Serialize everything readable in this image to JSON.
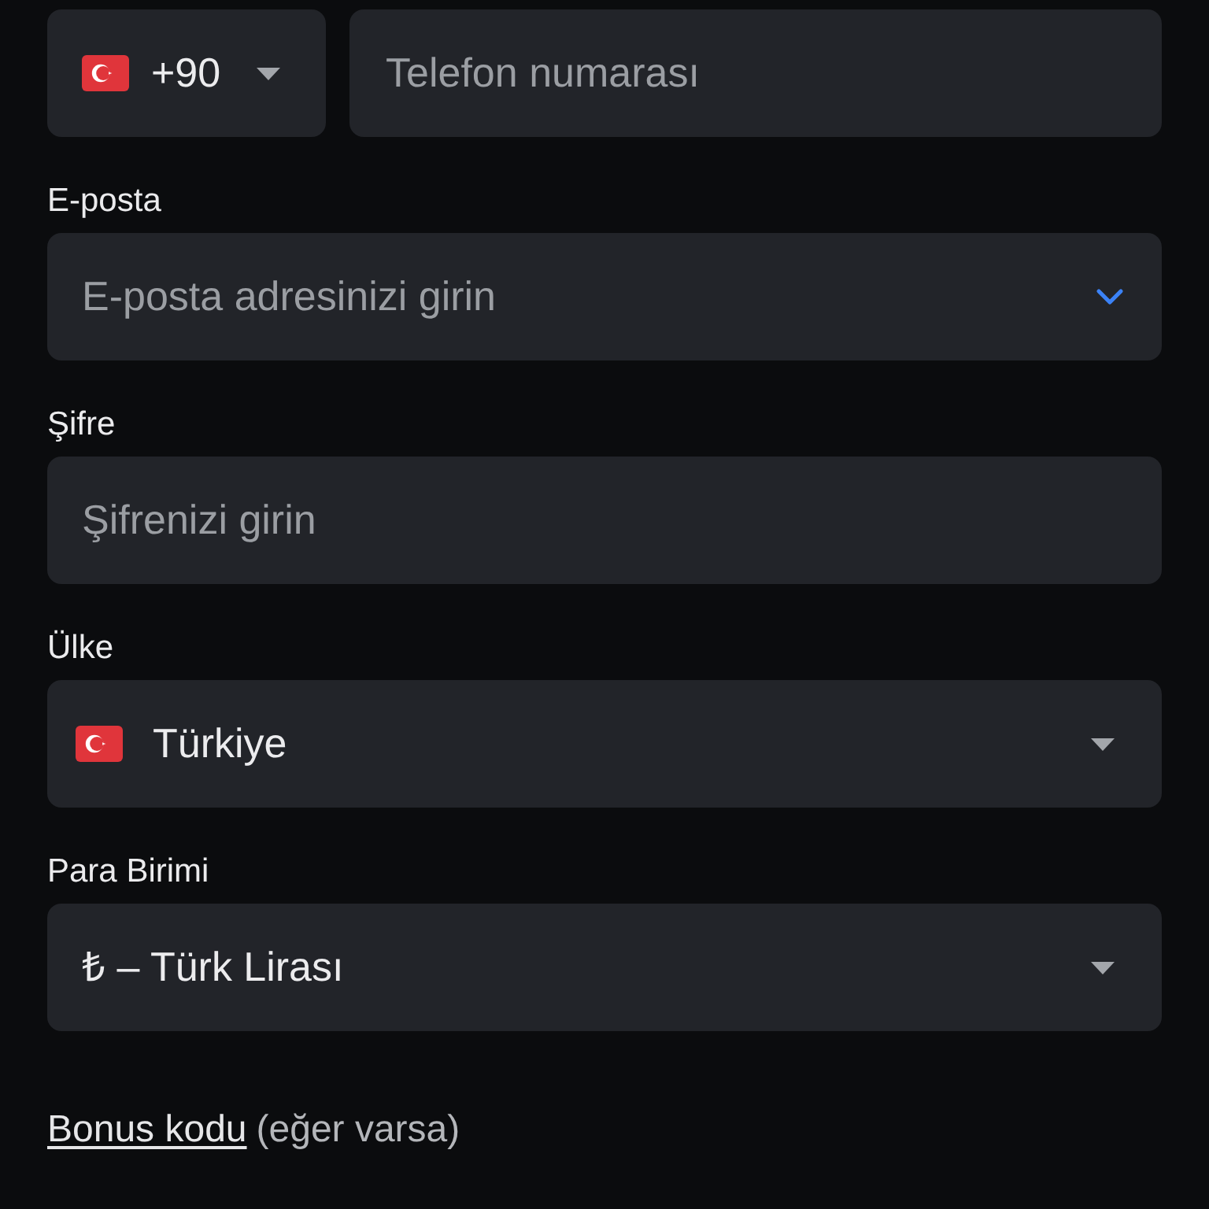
{
  "phone": {
    "country_code": {
      "kind": "flag_select",
      "value": "+90"
    },
    "number": {
      "placeholder": "Telefon numarası"
    }
  },
  "fields": [
    {
      "kind": "email",
      "label": "E-posta",
      "placeholder": "E-posta adresinizi girin"
    },
    {
      "kind": "password",
      "label": "Şifre",
      "placeholder": "Şifrenizi girin"
    },
    {
      "kind": "flag_select",
      "label": "Ülke",
      "value": "Türkiye"
    },
    {
      "kind": "select",
      "label": "Para Birimi",
      "value": "₺ – Türk Lirası"
    }
  ],
  "bonus": {
    "link": "Bonus kodu",
    "note": "(eğer varsa)"
  }
}
